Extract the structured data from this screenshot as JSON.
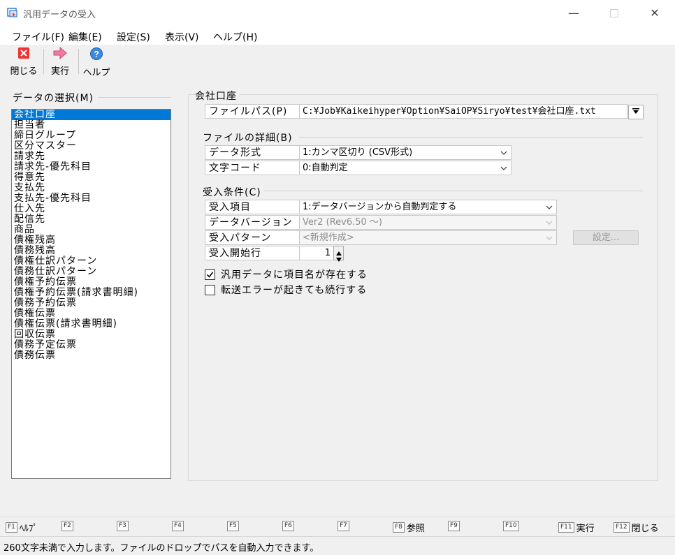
{
  "window": {
    "title": "汎用データの受入"
  },
  "menu": [
    "ファイル(F)",
    "編集(E)",
    "設定(S)",
    "表示(V)",
    "ヘルプ(H)"
  ],
  "toolbar": {
    "close": "閉じる",
    "execute": "実行",
    "help": "ヘルプ"
  },
  "data_select": {
    "label": "データの選択(M)",
    "items": [
      "会社口座",
      "担当者",
      "締日グループ",
      "区分マスター",
      "請求先",
      "請求先-優先科目",
      "得意先",
      "支払先",
      "支払先-優先科目",
      "仕入先",
      "配信先",
      "商品",
      "債権残高",
      "債務残高",
      "債権仕訳パターン",
      "債務仕訳パターン",
      "債権予約伝票",
      "債権予約伝票(請求書明細)",
      "債務予約伝票",
      "債権伝票",
      "債権伝票(請求書明細)",
      "回収伝票",
      "債務予定伝票",
      "債務伝票"
    ],
    "selected_index": 0
  },
  "panel": {
    "title": "会社口座",
    "file_path_label": "ファイルパス(P)",
    "file_path_value": "C:¥Job¥Kaikeihyper¥Option¥SaiOP¥Siryo¥test¥会社口座.txt",
    "file_details_label": "ファイルの詳細(B)",
    "data_format_label": "データ形式",
    "data_format_value": "1:カンマ区切り (CSV形式)",
    "char_code_label": "文字コード",
    "char_code_value": "0:自動判定",
    "import_conditions_label": "受入条件(C)",
    "import_item_label": "受入項目",
    "import_item_value": "1:データバージョンから自動判定する",
    "data_version_label": "データバージョン",
    "data_version_value": "Ver2 (Rev6.50 ～)",
    "import_pattern_label": "受入パターン",
    "import_pattern_value": "<新規作成>",
    "settings_button": "設定...",
    "start_row_label": "受入開始行",
    "start_row_value": "1",
    "check_header_label": "汎用データに項目名が存在する",
    "check_header_checked": true,
    "check_continue_label": "転送エラーが起きても続行する",
    "check_continue_checked": false
  },
  "fkeys": [
    {
      "key": "F1",
      "label": "ﾍﾙﾌﾟ"
    },
    {
      "key": "F2",
      "label": ""
    },
    {
      "key": "F3",
      "label": ""
    },
    {
      "key": "F4",
      "label": ""
    },
    {
      "key": "F5",
      "label": ""
    },
    {
      "key": "F6",
      "label": ""
    },
    {
      "key": "F7",
      "label": ""
    },
    {
      "key": "F8",
      "label": "参照"
    },
    {
      "key": "F9",
      "label": ""
    },
    {
      "key": "F10",
      "label": ""
    },
    {
      "key": "F11",
      "label": "実行"
    },
    {
      "key": "F12",
      "label": "閉じる"
    }
  ],
  "status": {
    "text": "260文字未満で入力します。ファイルのドロップでパスを自動入力できます。"
  }
}
